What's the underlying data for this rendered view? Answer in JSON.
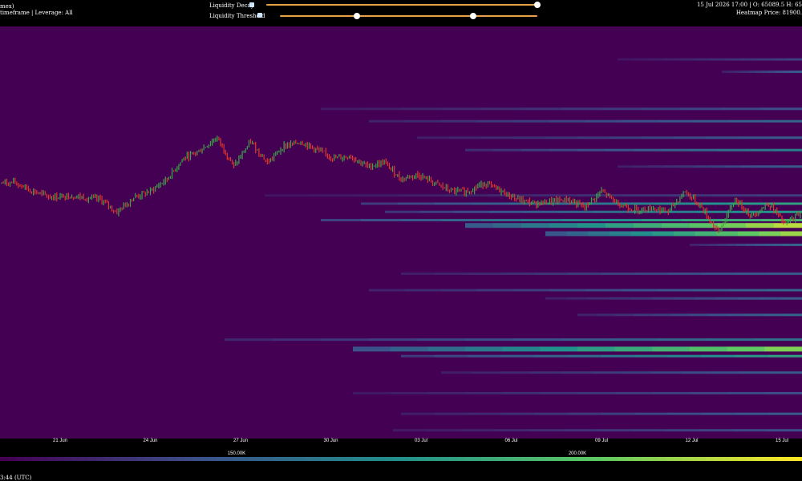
{
  "header": {
    "source_label": "mex)",
    "info_label": "timeframe | Leverage: All",
    "decay_label": "Liquidity Decay",
    "decay_value": 1.0,
    "threshold_label": "Liquidity Threshold",
    "threshold_range": [
      0.3,
      0.75
    ],
    "ohlc_text": "15 Jul 2026 17:00 | O: 65089.5 H: 65",
    "heatmap_price_text": "Heatmap Price: 81900."
  },
  "footer": {
    "timestamp_text": "3:44 (UTC)",
    "colorbar_ticks": [
      "150.00K",
      "200.00K"
    ]
  },
  "colors": {
    "background": "#440154",
    "up": "#3aa845",
    "down": "#e0382c",
    "slider": "#e9a24a"
  },
  "chart_data": {
    "type": "heatmap",
    "x_ticks": [
      "21 Jun",
      "24 Jun",
      "27 Jun",
      "30 Jun",
      "03 Jul",
      "06 Jul",
      "09 Jul",
      "12 Jul",
      "15 Jul"
    ],
    "colormap": "viridis",
    "colorbar_ticks": [
      "150.00K",
      "200.00K"
    ],
    "price_path": [
      0.62,
      0.62,
      0.6,
      0.585,
      0.59,
      0.585,
      0.58,
      0.55,
      0.585,
      0.6,
      0.63,
      0.68,
      0.7,
      0.73,
      0.66,
      0.72,
      0.67,
      0.71,
      0.72,
      0.7,
      0.68,
      0.685,
      0.66,
      0.67,
      0.63,
      0.64,
      0.62,
      0.6,
      0.6,
      0.62,
      0.6,
      0.58,
      0.57,
      0.575,
      0.58,
      0.56,
      0.6,
      0.57,
      0.555,
      0.56,
      0.55,
      0.6,
      0.56,
      0.5,
      0.58,
      0.54,
      0.57,
      0.52,
      0.55
    ],
    "liquidity_bands": [
      {
        "level": 0.08,
        "start": 0.77,
        "intensity": 0.2
      },
      {
        "level": 0.11,
        "start": 0.9,
        "intensity": 0.3
      },
      {
        "level": 0.2,
        "start": 0.4,
        "intensity": 0.25
      },
      {
        "level": 0.23,
        "start": 0.46,
        "intensity": 0.35
      },
      {
        "level": 0.27,
        "start": 0.52,
        "intensity": 0.3
      },
      {
        "level": 0.3,
        "start": 0.58,
        "intensity": 0.45
      },
      {
        "level": 0.34,
        "start": 0.77,
        "intensity": 0.3
      },
      {
        "level": 0.41,
        "start": 0.33,
        "intensity": 0.2
      },
      {
        "level": 0.43,
        "start": 0.45,
        "intensity": 0.6
      },
      {
        "level": 0.45,
        "start": 0.48,
        "intensity": 0.55
      },
      {
        "level": 0.47,
        "start": 0.4,
        "intensity": 0.7
      },
      {
        "level": 0.48,
        "start": 0.58,
        "intensity": 0.95
      },
      {
        "level": 0.5,
        "start": 0.68,
        "intensity": 0.9
      },
      {
        "level": 0.53,
        "start": 0.86,
        "intensity": 0.35
      },
      {
        "level": 0.6,
        "start": 0.5,
        "intensity": 0.3
      },
      {
        "level": 0.64,
        "start": 0.46,
        "intensity": 0.35
      },
      {
        "level": 0.66,
        "start": 0.68,
        "intensity": 0.3
      },
      {
        "level": 0.7,
        "start": 0.72,
        "intensity": 0.35
      },
      {
        "level": 0.76,
        "start": 0.28,
        "intensity": 0.4
      },
      {
        "level": 0.78,
        "start": 0.44,
        "intensity": 0.85
      },
      {
        "level": 0.8,
        "start": 0.5,
        "intensity": 0.6
      },
      {
        "level": 0.84,
        "start": 0.55,
        "intensity": 0.3
      },
      {
        "level": 0.89,
        "start": 0.44,
        "intensity": 0.25
      },
      {
        "level": 0.94,
        "start": 0.5,
        "intensity": 0.3
      },
      {
        "level": 0.98,
        "start": 0.49,
        "intensity": 0.25
      }
    ]
  }
}
